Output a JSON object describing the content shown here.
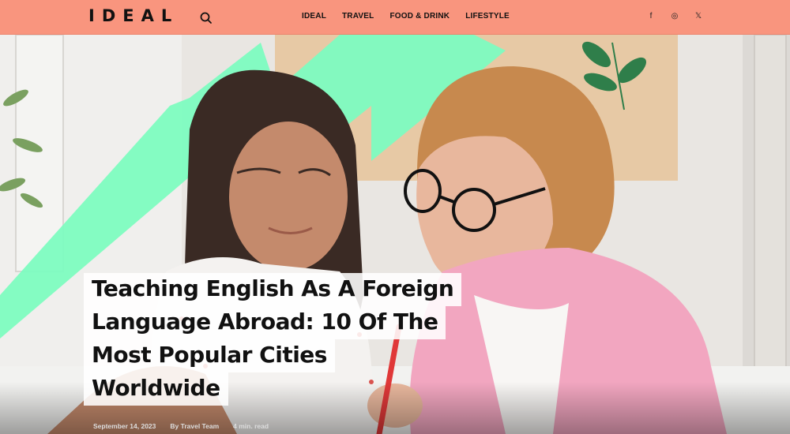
{
  "brand": {
    "logo": "IDEAL"
  },
  "nav": {
    "items": [
      "IDEAL",
      "TRAVEL",
      "FOOD & DRINK",
      "LIFESTYLE"
    ]
  },
  "social": {
    "icons": [
      "facebook-icon",
      "instagram-icon",
      "x-icon"
    ],
    "glyphs": [
      "f",
      "◎",
      "𝕏"
    ]
  },
  "colors": {
    "header_bg": "#f9957e",
    "accent_green": "#7dfcc0",
    "jacket_pink": "#f2a6c0"
  },
  "article": {
    "title_lines": [
      "Teaching English As A Foreign",
      "Language Abroad: 10 Of The",
      "Most Popular Cities",
      "Worldwide"
    ],
    "date": "September 14, 2023",
    "author": "By Travel Team",
    "read_time": "4 min. read"
  }
}
